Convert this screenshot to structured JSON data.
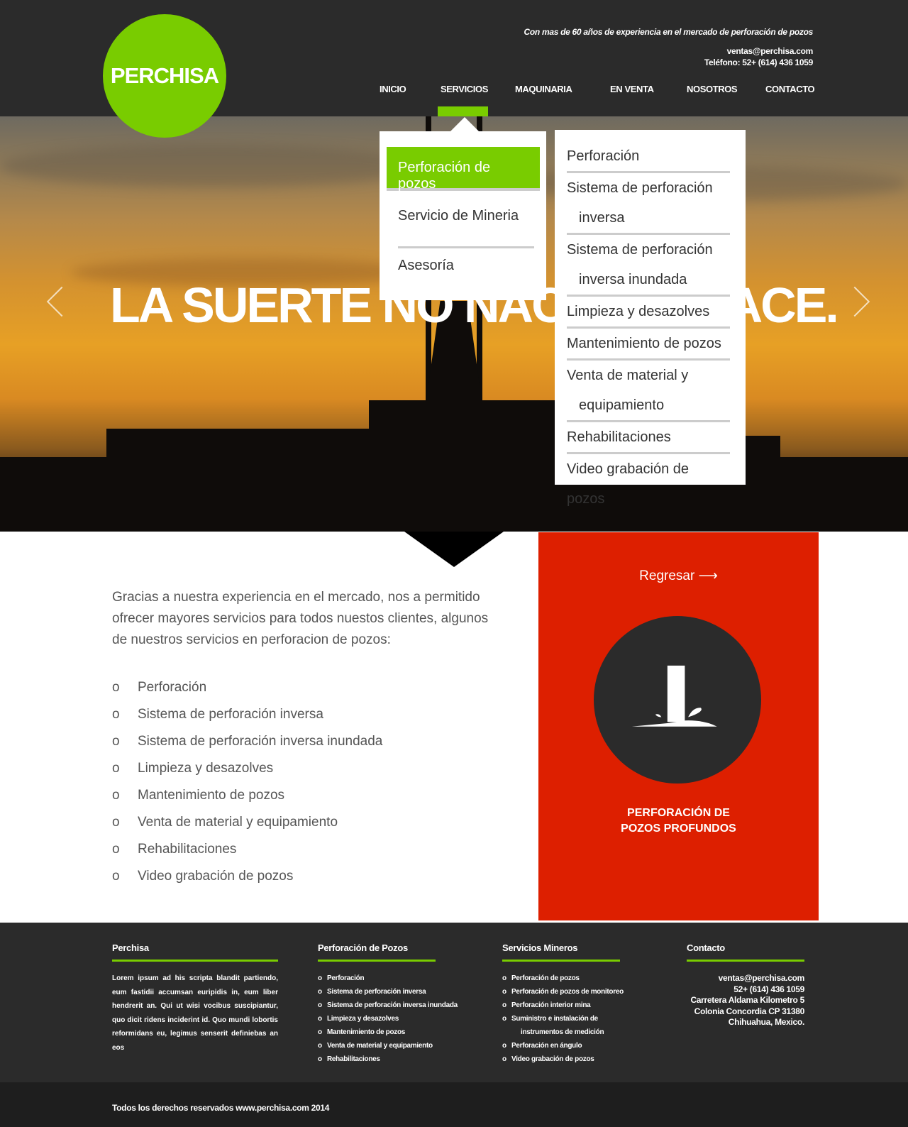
{
  "brand": {
    "logo": "PERCHISA",
    "accent": "#79cc00",
    "red": "#dd1f00"
  },
  "header": {
    "tagline": "Con mas de  60 años de experiencia  en el mercado de perforación de pozos",
    "email": "ventas@perchisa.com",
    "phone": "Teléfono: 52+ (614) 436 1059"
  },
  "nav": [
    {
      "label": "INICIO"
    },
    {
      "label": "SERVICIOS",
      "active": true
    },
    {
      "label": "MAQUINARIA"
    },
    {
      "label": "EN VENTA"
    },
    {
      "label": "NOSOTROS"
    },
    {
      "label": "CONTACTO"
    }
  ],
  "dropdown": {
    "primary": [
      "Perforación de pozos",
      "Servicio de Mineria",
      "Asesoría"
    ],
    "secondary": [
      [
        "Perforación"
      ],
      [
        "Sistema de perforación",
        "inversa"
      ],
      [
        "Sistema de perforación",
        "inversa inundada"
      ],
      [
        "Limpieza y desazolves"
      ],
      [
        "Mantenimiento de pozos"
      ],
      [
        "Venta de material y",
        "equipamiento"
      ],
      [
        "Rehabilitaciones"
      ],
      [
        "Video grabación de pozos"
      ]
    ]
  },
  "hero": {
    "headline": "LA SUERTE NO NACE, SE HACE.",
    "prev_icon": "chevron-left-icon",
    "next_icon": "chevron-right-icon"
  },
  "main": {
    "intro": "Gracias a nuestra experiencia en el mercado, nos a permitido ofrecer mayores servicios para todos nuestos clientes, algunos de nuestros servicios en perforacion de pozos:",
    "bullet": "o",
    "services": [
      "Perforación",
      "Sistema de perforación inversa",
      "Sistema de perforación inversa inundada",
      "Limpieza y desazolves",
      "Mantenimiento de pozos",
      "Venta de material y equipamiento",
      "Rehabilitaciones",
      "Video grabación de pozos"
    ]
  },
  "panel": {
    "back": "Regresar",
    "title_line1": "PERFORACIÓN DE",
    "title_line2": "POZOS PROFUNDOS",
    "icon": "well-drilling-icon"
  },
  "footer": {
    "col1": {
      "title": "Perchisa",
      "text": "Lorem ipsum ad his scripta blandit partiendo, eum fastidii accumsan euripidis in, eum liber hendrerit an. Qui ut wisi vocibus suscipiantur, quo dicit ridens inciderint id. Quo mundi lobortis reformidans eu, legimus senserit definiebas an eos"
    },
    "col2": {
      "title": "Perforación de Pozos",
      "items": [
        "Perforación",
        "Sistema de perforación inversa",
        "Sistema de perforación inversa inundada",
        "Limpieza y desazolves",
        "Mantenimiento de pozos",
        "Venta de material y equipamiento",
        "Rehabilitaciones"
      ]
    },
    "col3": {
      "title": "Servicios Mineros",
      "items": [
        "Perforación de pozos",
        "Perforación de pozos de monitoreo",
        "Perforación interior mina",
        "Suministro e instalación de",
        "instrumentos de medición",
        "Perforación en ángulo",
        "Video grabación de pozos"
      ]
    },
    "col4": {
      "title": "Contacto",
      "lines": [
        "ventas@perchisa.com",
        "52+ (614) 436 1059",
        "Carretera Aldama Kilometro 5",
        "Colonia Concordia CP 31380",
        "Chihuahua, Mexico."
      ]
    },
    "copyright": "Todos los derechos reservados www.perchisa.com 2014"
  }
}
